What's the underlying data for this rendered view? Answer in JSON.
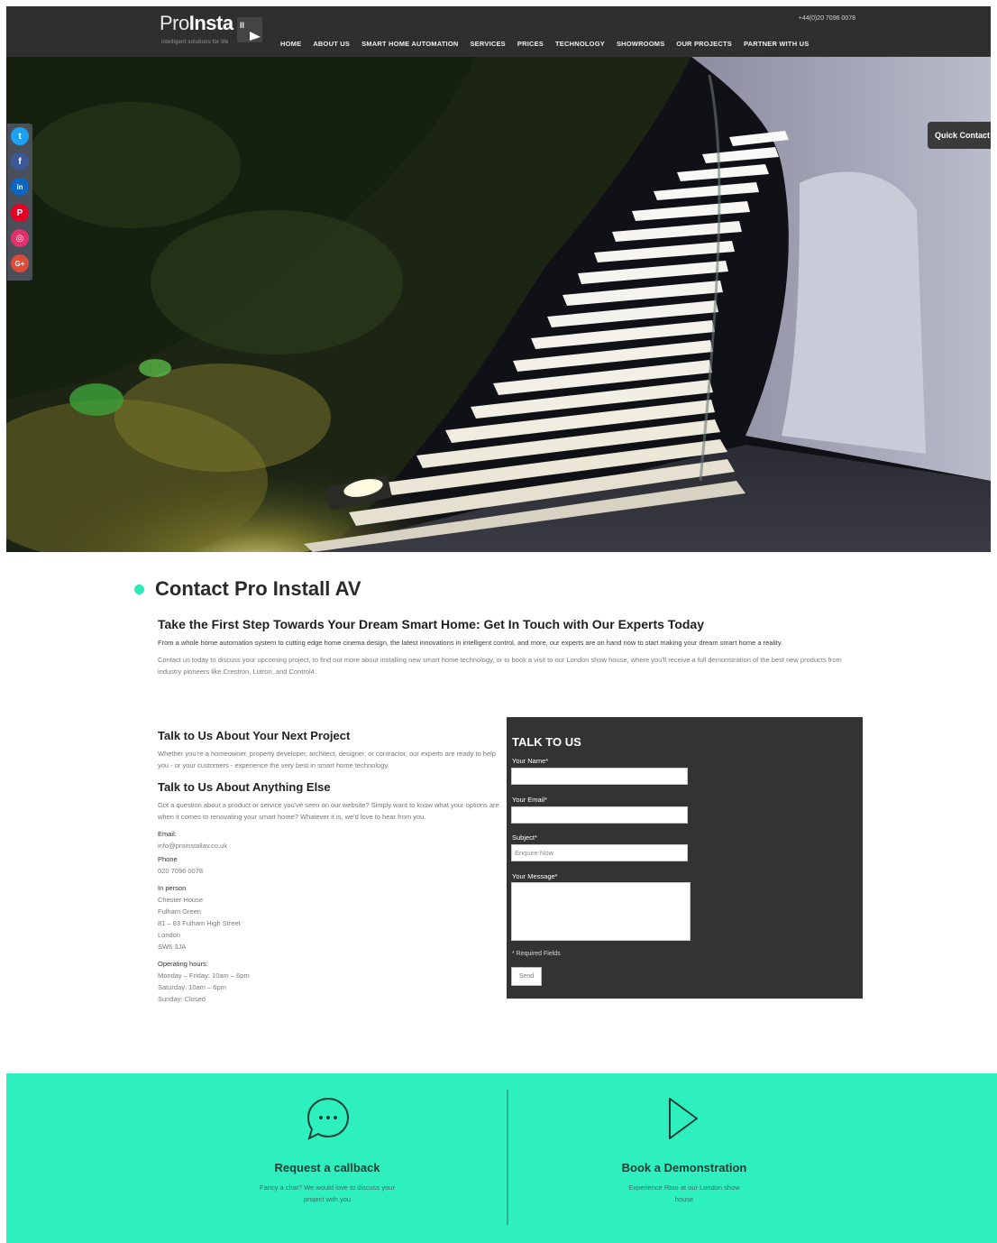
{
  "header": {
    "logo_text_light": "Pro",
    "logo_text_bold": "Insta",
    "logo_tagline": "intelligent solutions for life",
    "phone": "+44(0)20 7096 0078",
    "nav": [
      "HOME",
      "ABOUT US",
      "SMART HOME AUTOMATION",
      "SERVICES",
      "PRICES",
      "TECHNOLOGY",
      "SHOWROOMS",
      "OUR PROJECTS",
      "PARTNER WITH US"
    ]
  },
  "social": {
    "items": [
      {
        "icon": "twitter-icon",
        "glyph": "t",
        "color": "#1da1f2"
      },
      {
        "icon": "facebook-icon",
        "glyph": "f",
        "color": "#3b5998"
      },
      {
        "icon": "linkedin-icon",
        "glyph": "in",
        "color": "#0a66c2"
      },
      {
        "icon": "pinterest-icon",
        "glyph": "P",
        "color": "#e60023"
      },
      {
        "icon": "instagram-icon",
        "glyph": "◎",
        "color": "#e1306c"
      },
      {
        "icon": "google-plus-icon",
        "glyph": "G+",
        "color": "#dd4b39"
      }
    ]
  },
  "quick_contact": "Quick Contact",
  "content": {
    "page_title": "Contact Pro Install AV",
    "intro_heading": "Take the First Step Towards Your Dream Smart Home: Get In Touch with Our Experts Today",
    "intro_p1": "From a whole home automation system to cutting edge home cinema design, the latest innovations in intelligent control, and more, our experts are on hand now to start making your dream smart home a reality.",
    "intro_p2": "Contact us today to discuss your upcoming project, to find out more about installing new smart home technology, or to book a visit to our London show house, where you'll receive a full demonstration of the best new products from industry pioneers like Crestron, Lutron, and Control4.",
    "project_heading": "Talk to Us About Your Next Project",
    "project_text": "Whether you're a homeowner, property developer, architect, designer, or contractor, our experts are ready to help you - or your customers - experience the very best in smart home technology.",
    "else_heading": "Talk to Us About Anything Else",
    "else_text": "Got a question about a product or service you've seen on our website? Simply want to know what your options are when it comes to renovating your smart home? Whatever it is, we'd love to hear from you.",
    "email_label": "Email:",
    "email_value": "info@proinstallav.co.uk",
    "phone_label": "Phone",
    "phone_value": "020 7096 0078",
    "inperson_label": "In person",
    "address": [
      "Chester House",
      "Fulham Green",
      "81 – 83 Fulham High Street",
      "London",
      "SW6 3JA"
    ],
    "hours_label": "Operating hours:",
    "hours": [
      "Monday – Friday: 10am – 6pm",
      "Saturday: 10am – 6pm",
      "Sunday: Closed"
    ]
  },
  "form": {
    "title": "TALK TO US",
    "name_label": "Your Name*",
    "email_label": "Your Email*",
    "subject_label": "Subject*",
    "subject_value": "Enquire Now",
    "message_label": "Your Message*",
    "required_note": "* Required Fields",
    "send_label": "Send"
  },
  "cta": {
    "callback_title": "Request a callback",
    "callback_text": "Fancy a chat? We would love to discuss your project with you",
    "demo_title": "Book a Demonstration",
    "demo_text": "Experience Rtoo at our London show house"
  },
  "colors": {
    "accent": "#2ef0bf",
    "header_bg": "#2f2f2f",
    "form_bg": "#333333"
  }
}
